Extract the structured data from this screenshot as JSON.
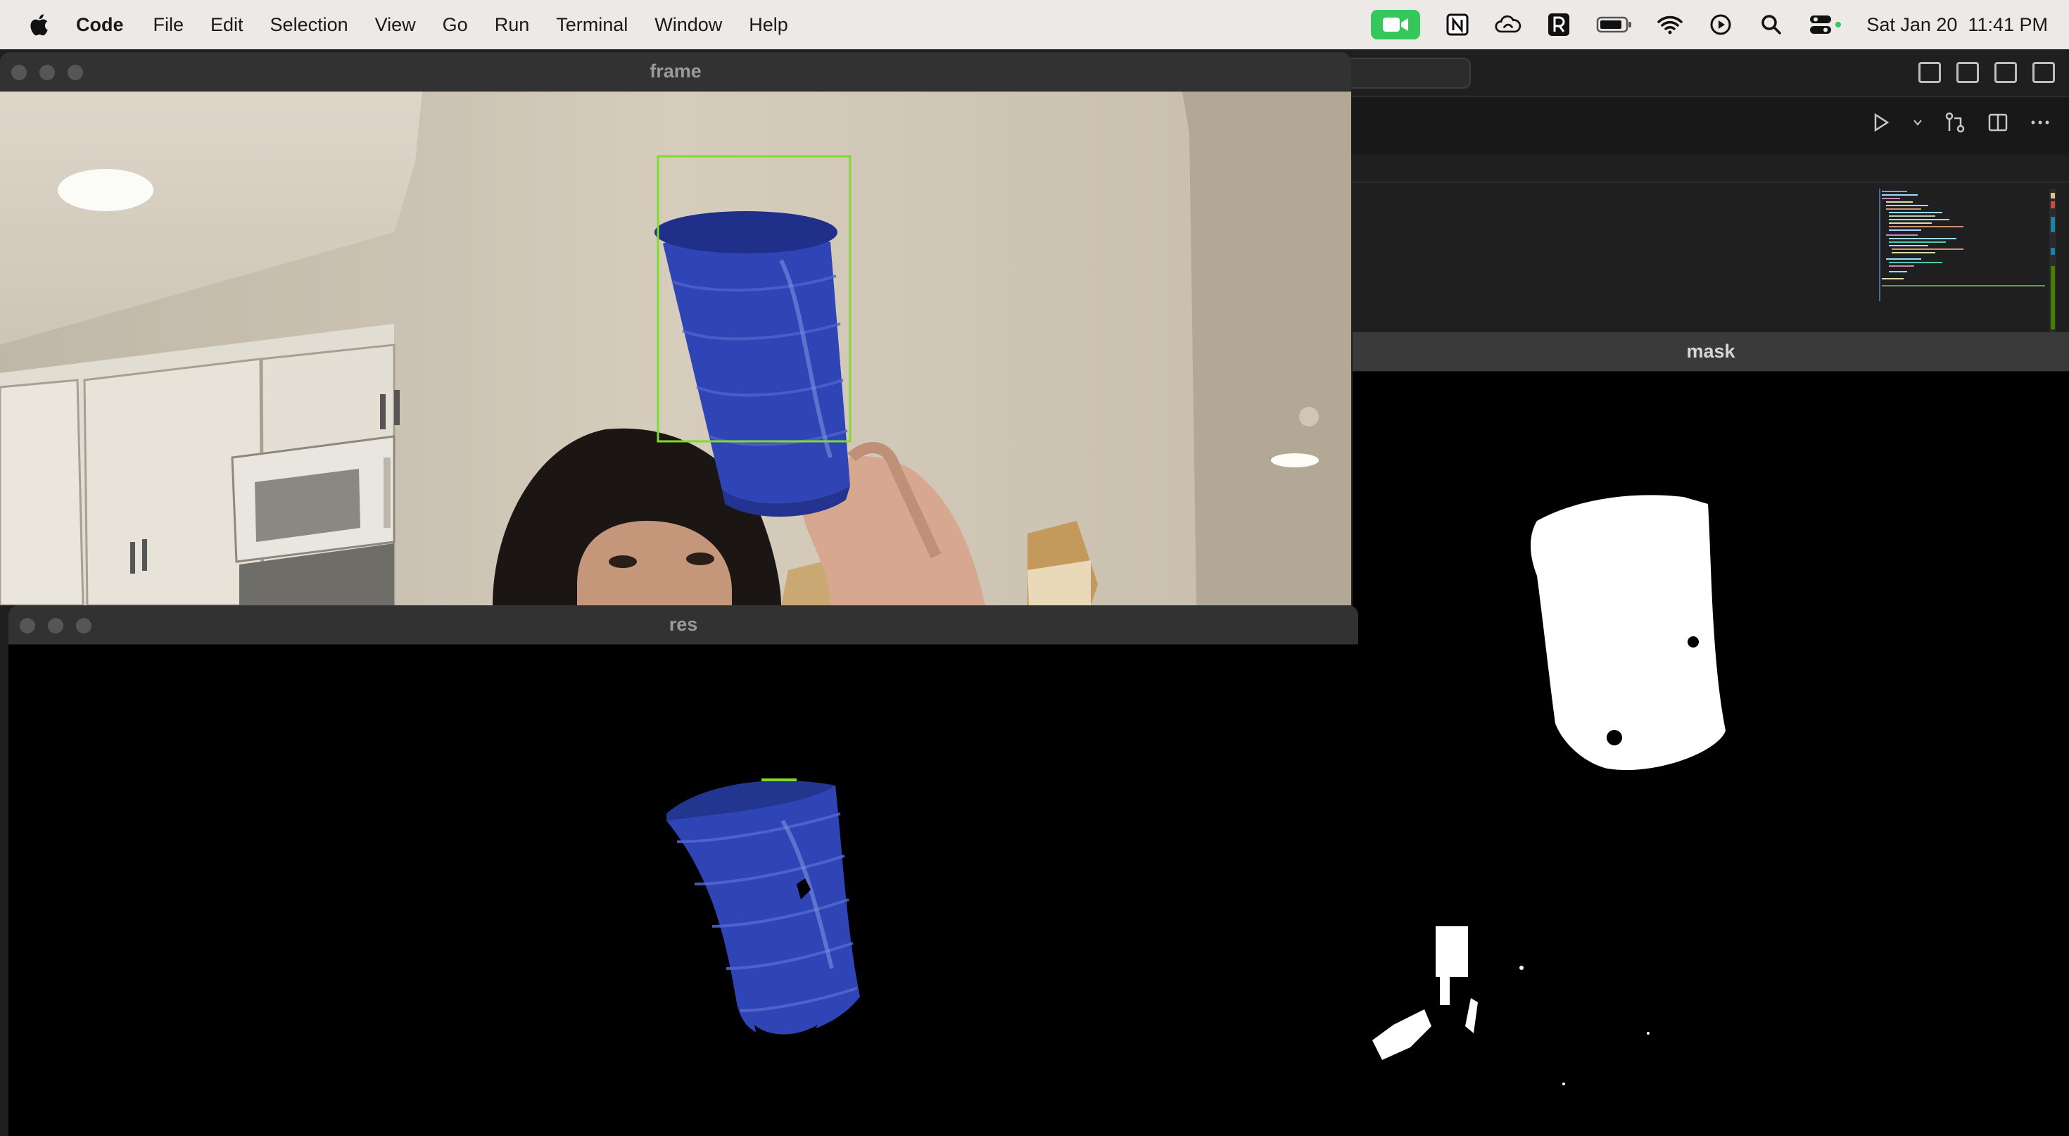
{
  "menubar": {
    "apple_icon": "apple-logo-icon",
    "app_name": "Code",
    "items": [
      "File",
      "Edit",
      "Selection",
      "View",
      "Go",
      "Run",
      "Terminal",
      "Window",
      "Help"
    ],
    "status_icons": [
      "facetime-camera-icon",
      "notion-icon",
      "creative-cloud-icon",
      "recall-r-icon",
      "battery-icon",
      "wifi-icon",
      "play-circle-icon",
      "spotlight-search-icon",
      "control-center-icon"
    ],
    "clock": {
      "date": "Sat Jan 20",
      "time": "11:41 PM"
    }
  },
  "windows": {
    "frame": {
      "title": "frame"
    },
    "res": {
      "title": "res"
    },
    "mask": {
      "title": "mask"
    }
  },
  "colors": {
    "detection_box": "#7ddc2c",
    "cup_blue": "#2f45b6",
    "facetime_green": "#34c759",
    "mask_white": "#ffffff"
  }
}
